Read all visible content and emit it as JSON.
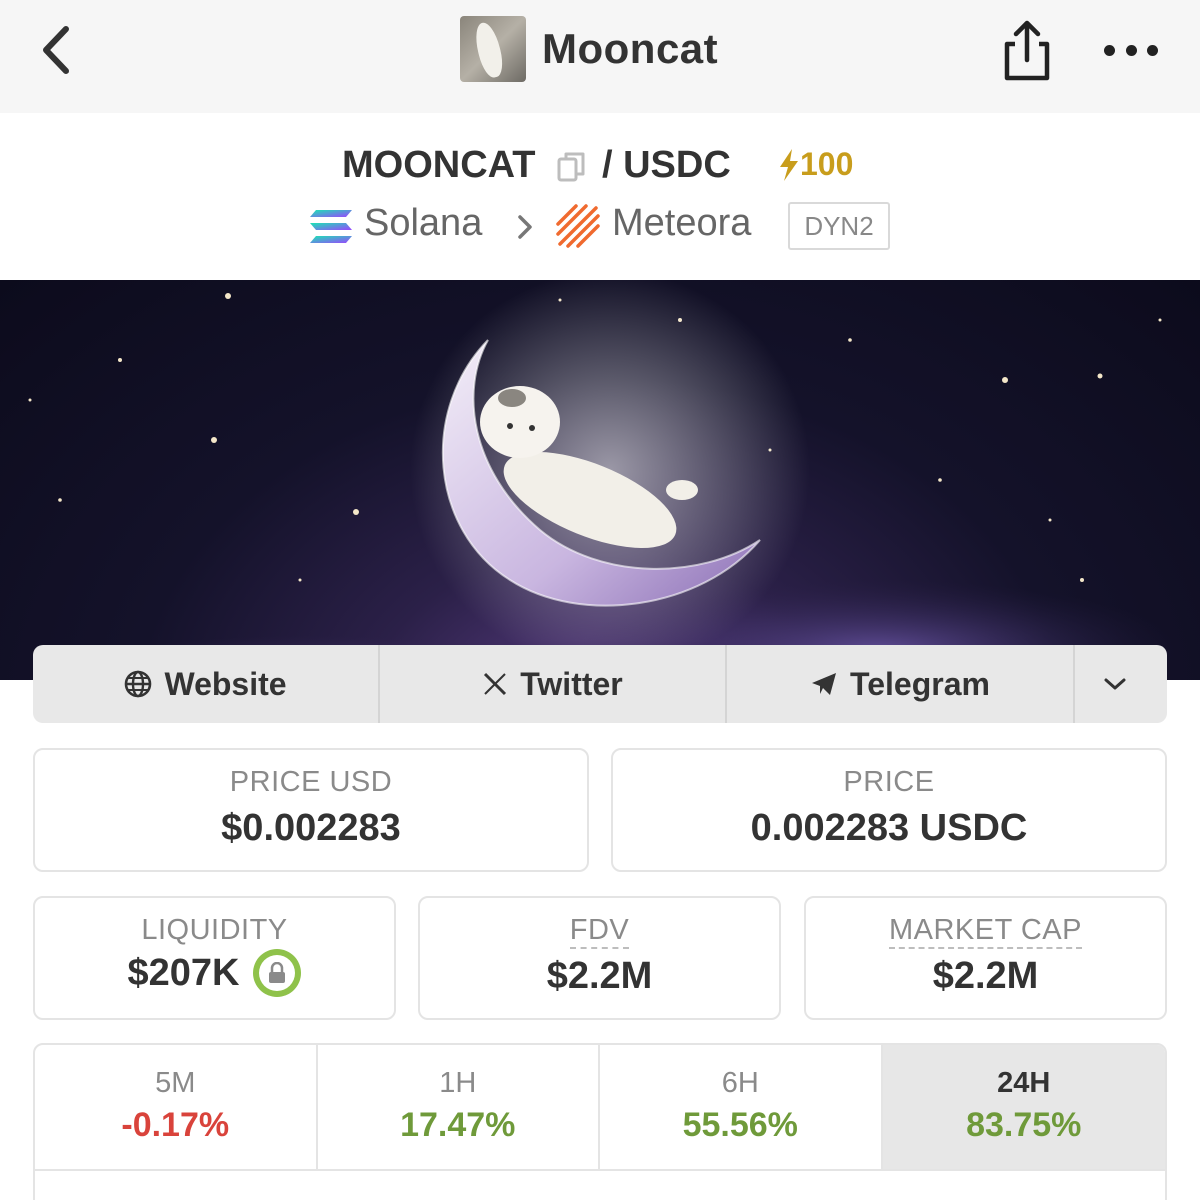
{
  "header": {
    "title": "Mooncat",
    "back_icon": "chevron-left-icon",
    "share_icon": "share-icon",
    "more_icon": "more-horizontal-icon"
  },
  "pair": {
    "base": "MOONCAT",
    "separator": "/ USDC",
    "boost": "100",
    "chain": "Solana",
    "dex": "Meteora",
    "pool_tag": "DYN2",
    "boost_color": "#c89d1c"
  },
  "banner": {
    "description_icon": "mooncat-banner-image"
  },
  "social": {
    "website": "Website",
    "twitter": "Twitter",
    "telegram": "Telegram"
  },
  "stats": {
    "price_usd_label": "PRICE USD",
    "price_usd": "$0.002283",
    "price_label": "PRICE",
    "price": "0.002283 USDC",
    "liquidity_label": "LIQUIDITY",
    "liquidity": "$207K",
    "fdv_label": "FDV",
    "fdv": "$2.2M",
    "mcap_label": "MARKET CAP",
    "mcap": "$2.2M"
  },
  "timeframes": [
    {
      "label": "5M",
      "value": "-0.17%"
    },
    {
      "label": "1H",
      "value": "17.47%"
    },
    {
      "label": "6H",
      "value": "55.56%"
    },
    {
      "label": "24H",
      "value": "83.75%"
    }
  ],
  "colors": {
    "negative": "#d9433b",
    "positive": "#6f9a3a",
    "lock": "#8fc24a"
  }
}
